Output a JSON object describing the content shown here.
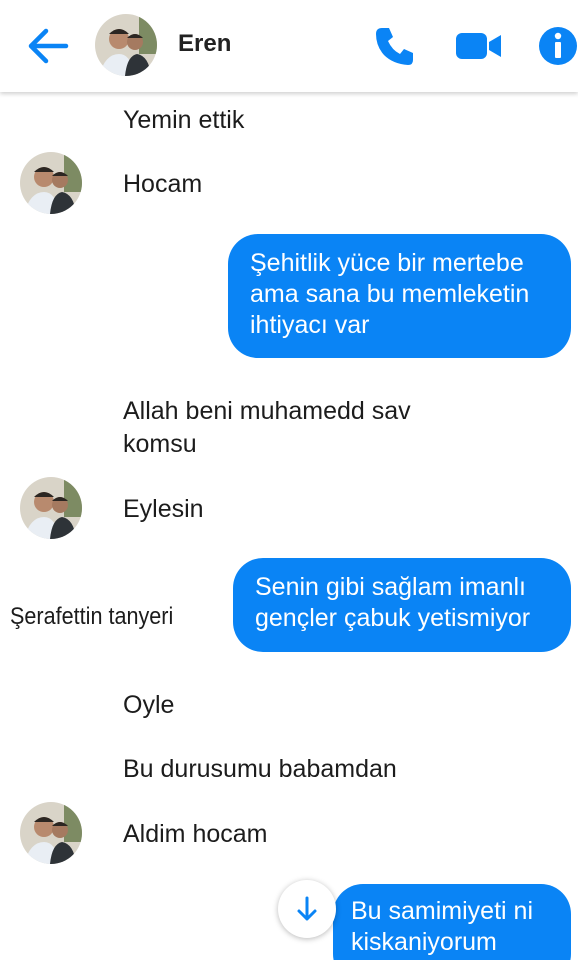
{
  "header": {
    "contact_name": "Eren",
    "icons": [
      "back-arrow-icon",
      "phone-icon",
      "video-camera-icon",
      "info-icon"
    ]
  },
  "colors": {
    "accent": "#0a84f5",
    "background": "#ffffff",
    "text": "#1c1c1c"
  },
  "messages": [
    {
      "direction": "in",
      "lines": [
        "Yemin ettik"
      ]
    },
    {
      "direction": "in",
      "lines": [
        "Hocam"
      ],
      "avatar": true
    },
    {
      "direction": "out",
      "lines": [
        "Şehitlik yüce bir mertebe",
        "ama sana bu memleketin",
        "ihtiyacı var"
      ]
    },
    {
      "direction": "in",
      "lines": [
        "Allah beni  muhamedd  sav",
        "komsu"
      ]
    },
    {
      "direction": "in",
      "lines": [
        "Eylesin"
      ],
      "avatar": true
    },
    {
      "direction": "out",
      "lines": [
        "Senin gibi sağlam imanlı",
        "gençler çabuk yetismiyor"
      ]
    },
    {
      "direction": "in",
      "lines": [
        "Oyle"
      ]
    },
    {
      "direction": "in",
      "lines": [
        "Bu  durusumu  babamdan"
      ]
    },
    {
      "direction": "in",
      "lines": [
        "Aldim  hocam"
      ],
      "avatar": true
    },
    {
      "direction": "out",
      "lines": [
        "Bu samimiyeti ni",
        "kiskaniyorum"
      ]
    }
  ],
  "watermark": "Şerafettin tanyeri",
  "scroll_button_icon": "arrow-down-icon"
}
